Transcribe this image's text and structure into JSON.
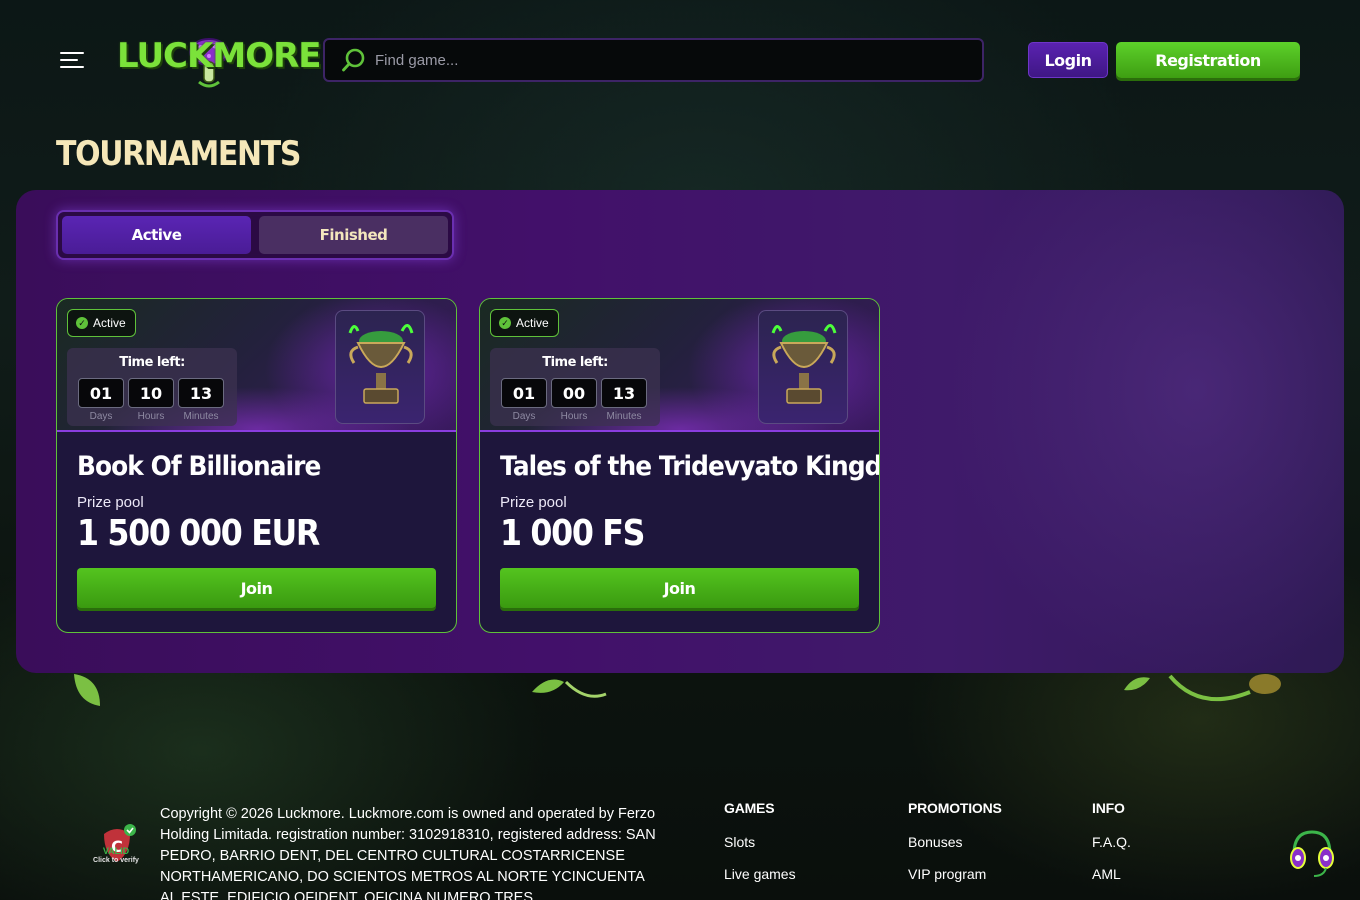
{
  "header": {
    "logo_text": "LUCK MORE",
    "search_placeholder": "Find game...",
    "login_label": "Login",
    "register_label": "Registration"
  },
  "page": {
    "title": "TOURNAMENTS"
  },
  "tabs": [
    {
      "label": "Active",
      "selected": true
    },
    {
      "label": "Finished",
      "selected": false
    }
  ],
  "tournaments": [
    {
      "status": "Active",
      "time_left_label": "Time left:",
      "timer": {
        "days": "01",
        "hours": "10",
        "minutes": "13"
      },
      "units": {
        "days": "Days",
        "hours": "Hours",
        "minutes": "Minutes"
      },
      "title": "Book Of Billionaire",
      "prize_label": "Prize pool",
      "prize_value": "1 500 000 EUR",
      "join_label": "Join"
    },
    {
      "status": "Active",
      "time_left_label": "Time left:",
      "timer": {
        "days": "01",
        "hours": "00",
        "minutes": "13"
      },
      "units": {
        "days": "Days",
        "hours": "Hours",
        "minutes": "Minutes"
      },
      "title": "Tales of the Tridevyato Kingdom",
      "prize_label": "Prize pool",
      "prize_value": "1 000 FS",
      "join_label": "Join"
    }
  ],
  "footer": {
    "license_valid": "VALID",
    "license_sub": "Click to verify",
    "copyright": "Copyright © 2026 Luckmore. Luckmore.com is owned and operated by Ferzo Holding Limitada. registration number: 3102918310, registered address: SAN PEDRO, BARRIO DENT, DEL CENTRO CULTURAL COSTARRICENSE NORTHAMERICANO, DO SCIENTOS METROS AL NORTE YCINCUENTA AL ESTE, EDIFICIO OFIDENT, OFICINA NUMERO TRES",
    "columns": [
      {
        "heading": "GAMES",
        "links": [
          "Slots",
          "Live games"
        ]
      },
      {
        "heading": "PROMOTIONS",
        "links": [
          "Bonuses",
          "VIP program"
        ]
      },
      {
        "heading": "INFO",
        "links": [
          "F.A.Q.",
          "AML"
        ]
      }
    ]
  },
  "colors": {
    "accent_green": "#5fc23a",
    "accent_purple": "#5a25b4",
    "title_cream": "#f5e7b8"
  }
}
